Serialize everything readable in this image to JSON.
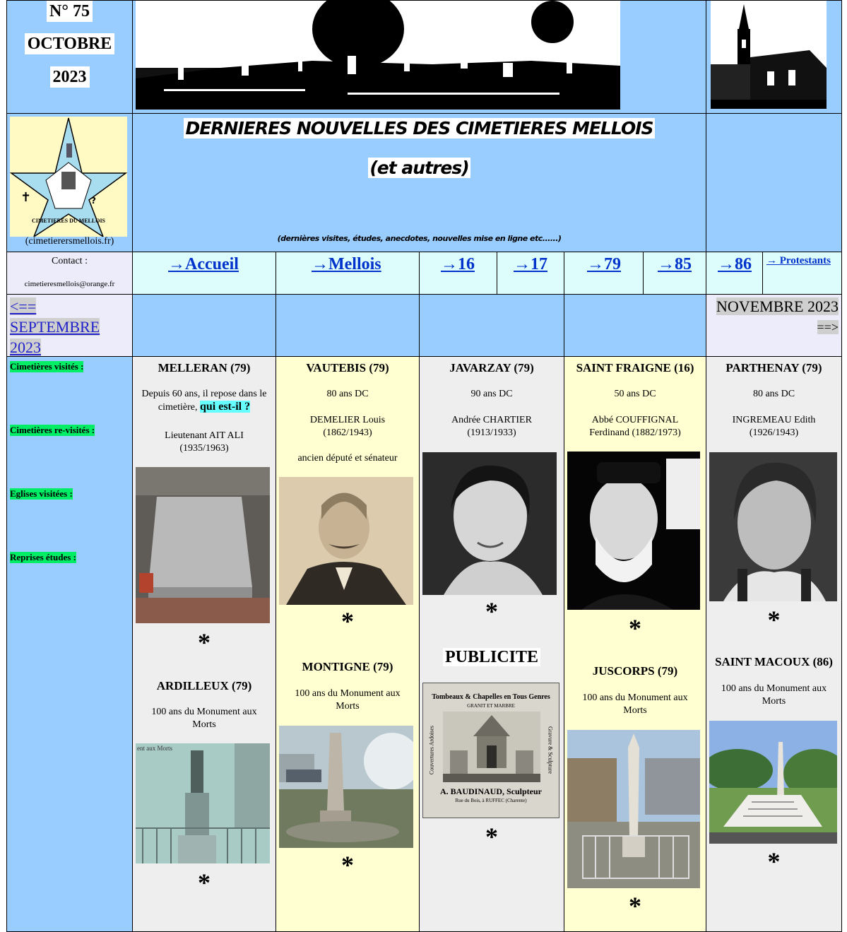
{
  "header": {
    "issue_number": "N° 75",
    "issue_month": "OCTOBRE",
    "issue_year": "2023",
    "main_title": "DERNIERES NOUVELLES DES CIMETIERES MELLOIS",
    "subtitle": "(et autres)",
    "tagline": "(dernières visites, études, anecdotes, nouvelles mise en ligne etc......)",
    "logo_text": "CIMETIERES DU MELLOIS",
    "site": "(cimetierersmellois.fr)"
  },
  "contact": {
    "label": "Contact :",
    "email": "cimetieresmellois@orange.fr"
  },
  "nav": {
    "accueil": "→Accueil",
    "mellois": "→Mellois",
    "d16": "→16",
    "d17": "→17",
    "d79": "→79",
    "d85": "→85",
    "d86": "→86",
    "protestants": "→ Protestants"
  },
  "month_nav": {
    "prev_arrow": "<==",
    "prev_month": "SEPTEMBRE",
    "prev_year": "2023",
    "next": "NOVEMBRE 2023",
    "next_arrow": "==>"
  },
  "sidebar": {
    "visited": "Cimetières visités :",
    "revisited": "Cimetières re-visités :",
    "churches": "Eglises visitées :",
    "studies": "Reprises études :"
  },
  "columns": {
    "c1": {
      "title": "MELLERAN (79)",
      "text_a": "Depuis 60 ans, il repose dans le cimetière,",
      "highlight": "qui est-il ?",
      "person": "Lieutenant AIT ALI",
      "dates": "(1935/1963)",
      "title2": "ARDILLEUX (79)",
      "text2": "100 ans du Monument aux Morts",
      "img2_caption": "ent aux Morts",
      "star": "*"
    },
    "c2": {
      "title": "VAUTEBIS (79)",
      "years": "80 ans DC",
      "person": "DEMELIER Louis",
      "dates": "(1862/1943)",
      "role": "ancien député et sénateur",
      "title2": "MONTIGNE (79)",
      "text2": "100 ans du Monument aux Morts",
      "star": "*"
    },
    "c3": {
      "title": "JAVARZAY (79)",
      "years": "90 ans DC",
      "person": "Andrée CHARTIER",
      "dates": "(1913/1933)",
      "title2": "PUBLICITE",
      "ad_line1": "Tombeaux & Chapelles en Tous Genres",
      "ad_line2": "GRANIT ET MARBRE",
      "ad_name": "A. BAUDINAUD, Sculpteur",
      "ad_addr": "Rue du Bois, à RUFFEC (Charente)",
      "ad_side_left": "Couvertures Ardoises",
      "ad_side_right": "Gravure & Sculpture",
      "star": "*"
    },
    "c4": {
      "title": "SAINT FRAIGNE (16)",
      "years": "50 ans DC",
      "person": "Abbé COUFFIGNAL",
      "dates": "Ferdinand (1882/1973)",
      "title2": "JUSCORPS (79)",
      "text2": "100 ans du Monument aux Morts",
      "star": "*"
    },
    "c5": {
      "title": "PARTHENAY (79)",
      "years": "80 ans DC",
      "person": "INGREMEAU Edith",
      "dates": "(1926/1943)",
      "title2": "SAINT MACOUX (86)",
      "text2": "100 ans du Monument aux Morts",
      "star": "*"
    }
  },
  "colors": {
    "blue": "#99ccff",
    "green_label": "#00ee66",
    "link": "#0033cc",
    "cyan_highlight": "#66ffff"
  }
}
